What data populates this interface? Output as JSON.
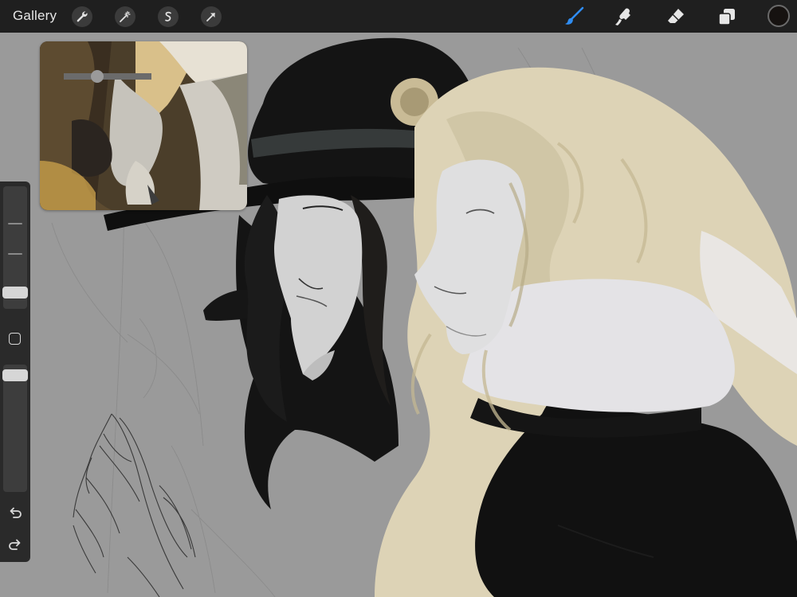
{
  "topbar": {
    "gallery_label": "Gallery",
    "action_tools": [
      "wrench-icon",
      "magic-wand-icon",
      "selection-icon",
      "transform-arrow-icon"
    ],
    "paint_tools": [
      "brush-icon",
      "smudge-icon",
      "eraser-icon",
      "layers-icon"
    ],
    "active_tool": "brush-icon",
    "active_color": "#161210"
  },
  "sidebar": {
    "controls": [
      "brush-size-slider",
      "modify-button",
      "opacity-slider",
      "undo-icon",
      "redo-icon"
    ]
  },
  "colors": {
    "toolbar_bg": "#1f1f1f",
    "canvas_bg": "#9a9a9a",
    "accent_blue": "#2f8df2",
    "hair_blonde": "#ddd3b6"
  }
}
